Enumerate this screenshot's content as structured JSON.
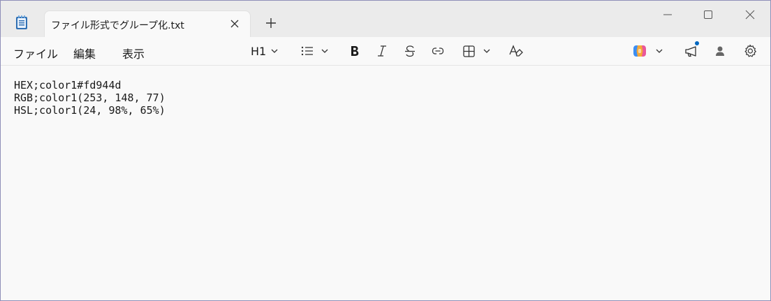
{
  "tab": {
    "title": "ファイル形式でグループ化.txt"
  },
  "menu": {
    "file": "ファイル",
    "edit": "編集",
    "view": "表示"
  },
  "toolbar": {
    "heading": "H1"
  },
  "editor": {
    "lines": [
      "HEX;color1#fd944d",
      "RGB;color1(253, 148, 77)",
      "HSL;color1(24, 98%, 65%)"
    ]
  },
  "icons": {
    "app": "notepad-icon",
    "close_tab": "close-icon",
    "new_tab": "plus-icon",
    "minimize": "minimize-icon",
    "maximize": "maximize-icon",
    "close_window": "close-icon",
    "list": "bulleted-list-icon",
    "bold": "bold-icon",
    "italic": "italic-icon",
    "strikethrough": "strikethrough-icon",
    "link": "link-icon",
    "table": "table-icon",
    "clear_format": "clear-formatting-icon",
    "copilot": "copilot-icon",
    "announce": "megaphone-icon",
    "account": "person-icon",
    "settings": "gear-icon"
  },
  "colors": {
    "accent": "#0067c0",
    "notification_dot": "#0067c0"
  }
}
